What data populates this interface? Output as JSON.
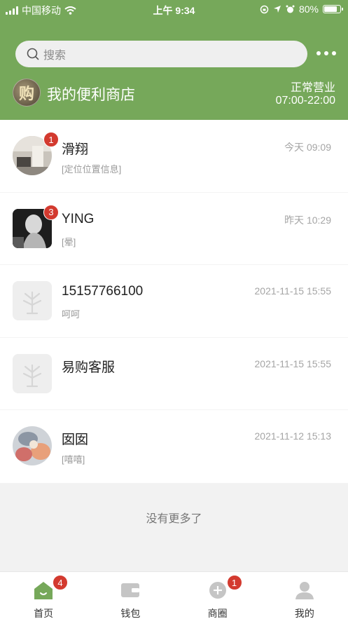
{
  "status_bar": {
    "carrier": "中国移动",
    "time": "上午 9:34",
    "battery": "80%",
    "battery_level": 0.8
  },
  "search": {
    "placeholder": "搜索"
  },
  "store": {
    "avatar_char": "购",
    "name": "我的便利商店",
    "status": "正常营业",
    "hours": "07:00-22:00"
  },
  "conversations": [
    {
      "name": "滑翔",
      "preview": "[定位位置信息]",
      "time": "今天 09:09",
      "badge": "1",
      "avatar": "photo-room"
    },
    {
      "name": "YING",
      "preview": "[晕]",
      "time": "昨天 10:29",
      "badge": "3",
      "avatar": "photo-portrait"
    },
    {
      "name": "15157766100",
      "preview": "呵呵",
      "time": "2021-11-15 15:55",
      "badge": "",
      "avatar": "default-tree"
    },
    {
      "name": "易购客服",
      "preview": "",
      "time": "2021-11-15 15:55",
      "badge": "",
      "avatar": "default-tree"
    },
    {
      "name": "囡囡",
      "preview": "[嘻嘻]",
      "time": "2021-11-12 15:13",
      "badge": "",
      "avatar": "photo-colorful"
    }
  ],
  "footer_note": "没有更多了",
  "tabs": [
    {
      "label": "首页",
      "icon": "home-icon",
      "badge": "4",
      "active": true
    },
    {
      "label": "钱包",
      "icon": "wallet-icon",
      "badge": ""
    },
    {
      "label": "商圈",
      "icon": "plus-circle-icon",
      "badge": "1"
    },
    {
      "label": "我的",
      "icon": "user-icon",
      "badge": ""
    }
  ],
  "colors": {
    "brand": "#76a85a",
    "badge": "#d33a2f"
  }
}
